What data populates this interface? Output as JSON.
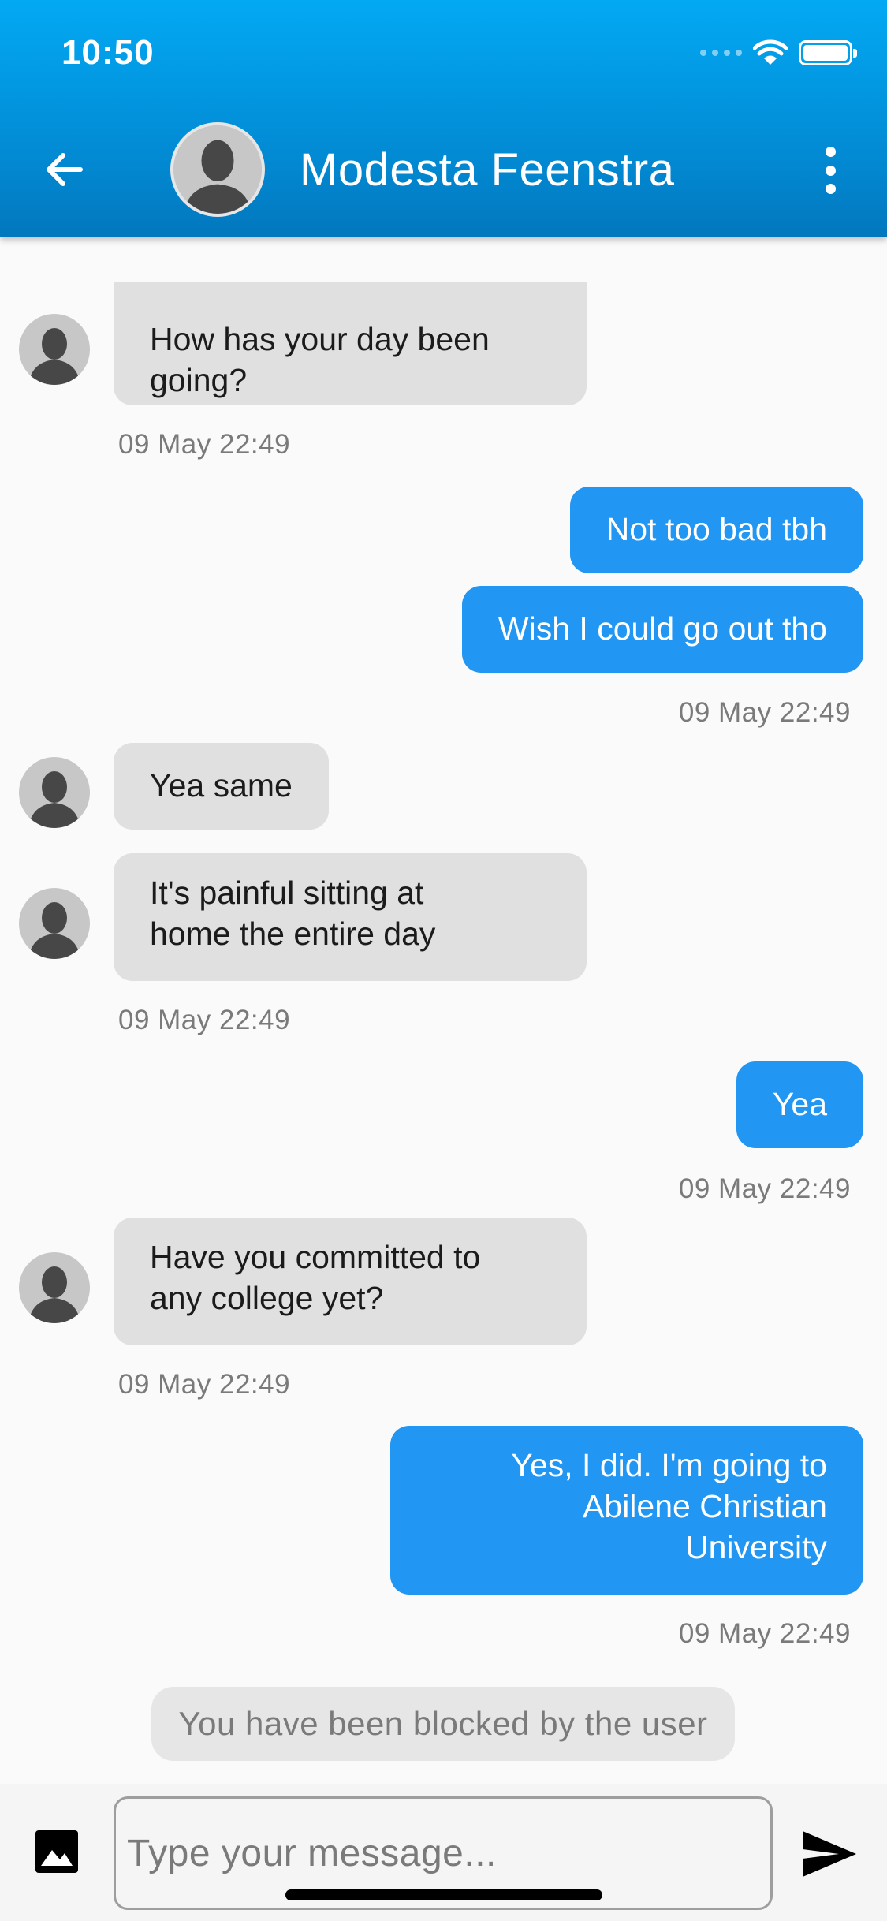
{
  "status_bar": {
    "time": "10:50"
  },
  "header": {
    "contact_name": "Modesta Feenstra"
  },
  "messages": [
    {
      "side": "in",
      "text_lines": [
        "How has your day been",
        "going?"
      ]
    },
    {
      "side": "in_ts",
      "text": "09 May 22:49"
    },
    {
      "side": "out",
      "text": "Not too bad tbh"
    },
    {
      "side": "out",
      "text": "Wish I could go out tho"
    },
    {
      "side": "out_ts",
      "text": "09 May 22:49"
    },
    {
      "side": "in",
      "text": "Yea same"
    },
    {
      "side": "in",
      "text_lines": [
        "It's painful sitting at",
        "home the entire day"
      ]
    },
    {
      "side": "in_ts",
      "text": "09 May 22:49"
    },
    {
      "side": "out",
      "text": "Yea"
    },
    {
      "side": "out_ts",
      "text": "09 May 22:49"
    },
    {
      "side": "in",
      "text_lines": [
        "Have you committed to",
        "any college yet?"
      ]
    },
    {
      "side": "in_ts",
      "text": "09 May 22:49"
    },
    {
      "side": "out",
      "text_lines": [
        "Yes, I did. I'm going to",
        "Abilene Christian",
        "University"
      ]
    },
    {
      "side": "out_ts",
      "text": "09 May 22:49"
    }
  ],
  "blocked_notice": "You have been blocked by the user",
  "composer": {
    "placeholder": "Type your message..."
  },
  "icons": {
    "back": "arrow-left-icon",
    "menu": "more-vertical-icon",
    "image": "image-icon",
    "send": "send-icon"
  },
  "colors": {
    "header": "#0288d1",
    "outgoing_bubble": "#2196f3",
    "incoming_bubble": "#e0e0e0"
  }
}
